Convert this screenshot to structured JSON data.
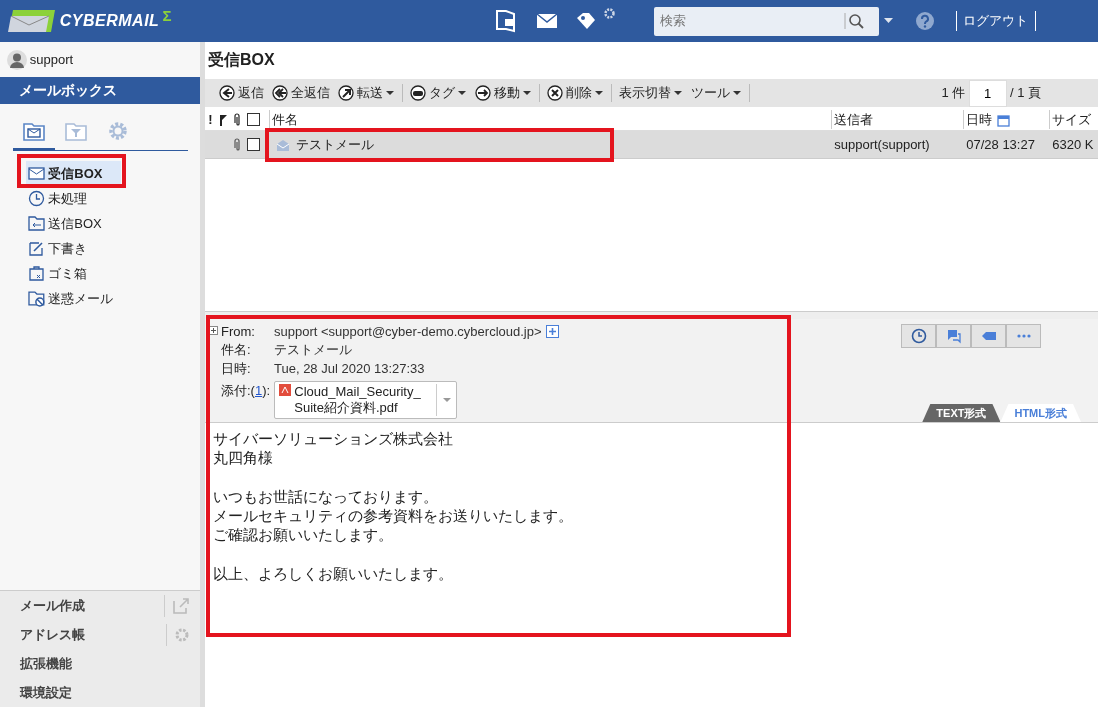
{
  "header": {
    "logo": "CYBERMAIL",
    "logo_mark": "Σ",
    "search": {
      "placeholder": "検索"
    },
    "logout": "ログアウト"
  },
  "user": {
    "name": "support"
  },
  "mailbox_title": "メールボックス",
  "sidebar_tabs": [
    {
      "kind": "mail",
      "selected": true
    },
    {
      "kind": "filter",
      "selected": false
    },
    {
      "kind": "settings",
      "selected": false
    }
  ],
  "folders": [
    {
      "label": "受信BOX",
      "kind": "inbox",
      "selected": true,
      "highlighted": true
    },
    {
      "label": "未処理",
      "kind": "clock",
      "selected": false,
      "highlighted": false
    },
    {
      "label": "送信BOX",
      "kind": "sent",
      "selected": false,
      "highlighted": false
    },
    {
      "label": "下書き",
      "kind": "draft",
      "selected": false,
      "highlighted": false
    },
    {
      "label": "ゴミ箱",
      "kind": "trash",
      "selected": false,
      "highlighted": false
    },
    {
      "label": "迷惑メール",
      "kind": "spam",
      "selected": false,
      "highlighted": false
    }
  ],
  "bottom_nav": [
    {
      "label": "メール作成",
      "kind": "external"
    },
    {
      "label": "アドレス帳",
      "kind": "settings"
    },
    {
      "label": "拡張機能",
      "kind": "plain"
    },
    {
      "label": "環境設定",
      "kind": "plain"
    }
  ],
  "folder_title": "受信BOX",
  "toolbar": [
    {
      "label": "返信",
      "kind": "reply",
      "dropdown": false
    },
    {
      "label": "全返信",
      "kind": "reply-all",
      "dropdown": false
    },
    {
      "label": "転送",
      "kind": "forward",
      "dropdown": true
    },
    {
      "kind": "separator"
    },
    {
      "label": "タグ",
      "kind": "tag",
      "dropdown": true
    },
    {
      "label": "移動",
      "kind": "move",
      "dropdown": true
    },
    {
      "kind": "separator"
    },
    {
      "label": "削除",
      "kind": "delete",
      "dropdown": true
    },
    {
      "kind": "separator"
    },
    {
      "label": "表示切替",
      "kind": "text",
      "dropdown": true
    },
    {
      "label": "ツール",
      "kind": "text",
      "dropdown": true
    },
    {
      "kind": "separator"
    }
  ],
  "pager": {
    "count": "1 件",
    "page": "1",
    "total": "/ 1 頁"
  },
  "list_header": {
    "priority": "!",
    "checked": false,
    "columns": [
      "件名",
      "送信者",
      "日時",
      "サイズ"
    ]
  },
  "messages": [
    {
      "subject": "テストメール",
      "sender": "support(support)",
      "date": "07/28 13:27",
      "size": "6320 K",
      "attachment": true,
      "checked": false,
      "selected": true,
      "highlighted": true
    }
  ],
  "preview": {
    "highlighted": true,
    "fields": [
      {
        "label": "From:",
        "value": "support <support@cyber-demo.cybercloud.jp>"
      },
      {
        "label": "件名:",
        "value": "テストメール"
      },
      {
        "label": "日時:",
        "value": "Tue, 28 Jul 2020 13:27:33"
      }
    ],
    "attachment": {
      "label_before": "添付:(",
      "count": "1",
      "label_after": "):",
      "file": "Cloud_Mail_Security_Suite紹介資料.pdf"
    },
    "actions": [
      {
        "kind": "clock"
      },
      {
        "kind": "chat"
      },
      {
        "kind": "tag"
      },
      {
        "kind": "more"
      }
    ],
    "view_tabs": [
      {
        "label": "TEXT形式",
        "selected": false
      },
      {
        "label": "HTML形式",
        "selected": true
      }
    ],
    "body": [
      [
        "サイバーソリューションズ株式会社",
        "丸四角様"
      ],
      [
        "いつもお世話になっております。",
        "メールセキュリティの参考資料をお送りいたします。",
        "ご確認お願いいたします。"
      ],
      [
        "以上、よろしくお願いいたします。"
      ]
    ]
  }
}
